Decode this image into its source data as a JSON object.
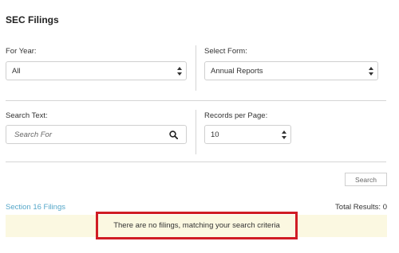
{
  "page": {
    "title": "SEC Filings"
  },
  "filters": {
    "year_label": "For Year:",
    "year_value": "All",
    "form_label": "Select Form:",
    "form_value": "Annual Reports",
    "search_label": "Search Text:",
    "search_placeholder": "Search For",
    "search_value": "",
    "records_label": "Records per Page:",
    "records_value": "10"
  },
  "actions": {
    "search_button": "Search"
  },
  "results": {
    "section_link": "Section 16 Filings",
    "total_results": "Total Results: 0",
    "empty_message": "There are no filings, matching your search criteria"
  },
  "colors": {
    "link": "#56a7c9",
    "highlight_border": "#d01c24",
    "notice_background": "#fbf8e1"
  },
  "icons": {
    "search": "magnifier-icon",
    "select": "up-down-arrows-icon"
  }
}
